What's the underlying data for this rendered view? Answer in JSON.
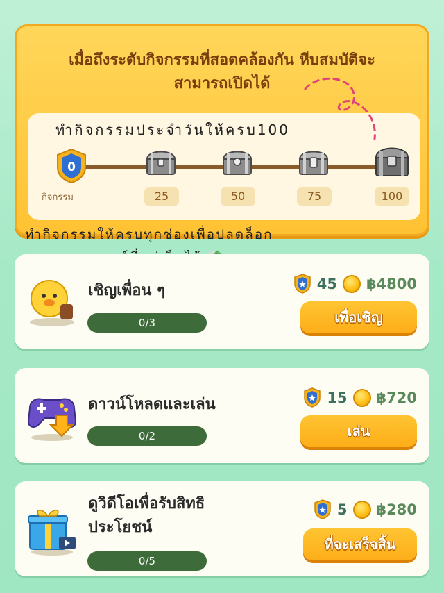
{
  "banner": {
    "message_line1": "เมื่อถึงระดับกิจกรรมที่สอดคล้องกัน หีบสมบัติจะ",
    "message_line2": "สามารถเปิดได้"
  },
  "progress": {
    "title": "ทำกิจกรรมประจำวันให้ครบ100",
    "current_value": "0",
    "current_label": "กิจกรรม",
    "milestones": [
      "25",
      "50",
      "75",
      "100"
    ]
  },
  "unlock_hint": {
    "line1": "ทำกิจกรรมให้ครบทุกช่องเพื่อปลดล็อก",
    "line2": "แบงค์ที่แช่เย็นไว้ 💸"
  },
  "tasks": [
    {
      "title_line1": "เชิญเพื่อน ๆ",
      "title_line2": "",
      "progress": "0/3",
      "badge_points": "45",
      "coin_amount": "฿4800",
      "button_label": "เพื่อเชิญ",
      "icon": "duck-icon"
    },
    {
      "title_line1": "ดาวน์โหลดและเล่น",
      "title_line2": "",
      "progress": "0/2",
      "badge_points": "15",
      "coin_amount": "฿720",
      "button_label": "เล่น",
      "icon": "gamepad-download-icon"
    },
    {
      "title_line1": "ดูวิดีโอเพื่อรับสิทธิ",
      "title_line2": "ประโยชน์",
      "progress": "0/5",
      "badge_points": "5",
      "coin_amount": "฿280",
      "button_label": "ที่จะเสร็จสิ้น",
      "icon": "gift-video-icon"
    }
  ],
  "colors": {
    "background": "#a6e9c7",
    "banner": "#ffc233",
    "button": "#fdae18",
    "progress_bar": "#3e6b3a",
    "dash_line": "#e0457a"
  }
}
